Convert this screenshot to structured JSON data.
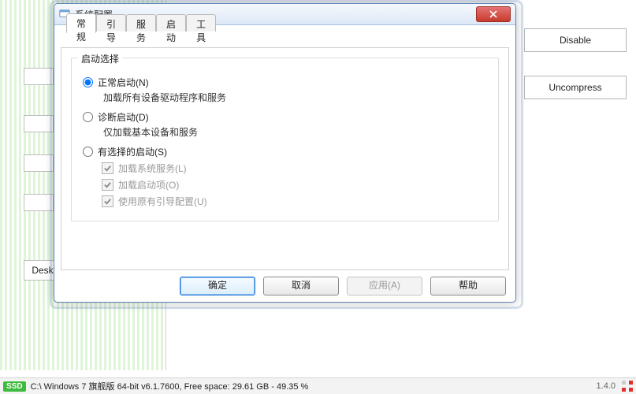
{
  "bg_buttons": {
    "disable": "Disable",
    "uncompress": "Uncompress",
    "desk": "Desk"
  },
  "dialog": {
    "title": "系统配置",
    "tabs": [
      "常规",
      "引导",
      "服务",
      "启动",
      "工具"
    ],
    "active_tab_index": 0,
    "group_label": "启动选择",
    "options": {
      "normal": {
        "label": "正常启动(N)",
        "sub": "加载所有设备驱动程序和服务"
      },
      "diag": {
        "label": "诊断启动(D)",
        "sub": "仅加载基本设备和服务"
      },
      "select": {
        "label": "有选择的启动(S)"
      }
    },
    "selective_checks": [
      {
        "label": "加载系统服务(L)",
        "checked": true
      },
      {
        "label": "加载启动项(O)",
        "checked": true
      },
      {
        "label": "使用原有引导配置(U)",
        "checked": true
      }
    ],
    "buttons": {
      "ok": "确定",
      "cancel": "取消",
      "apply": "应用(A)",
      "help": "帮助"
    }
  },
  "statusbar": {
    "ssd": "SSD",
    "text": "C:\\ Windows 7 旗舰版  64-bit v6.1.7600, Free space: 29.61 GB - 49.35 %",
    "version": "1.4.0"
  }
}
